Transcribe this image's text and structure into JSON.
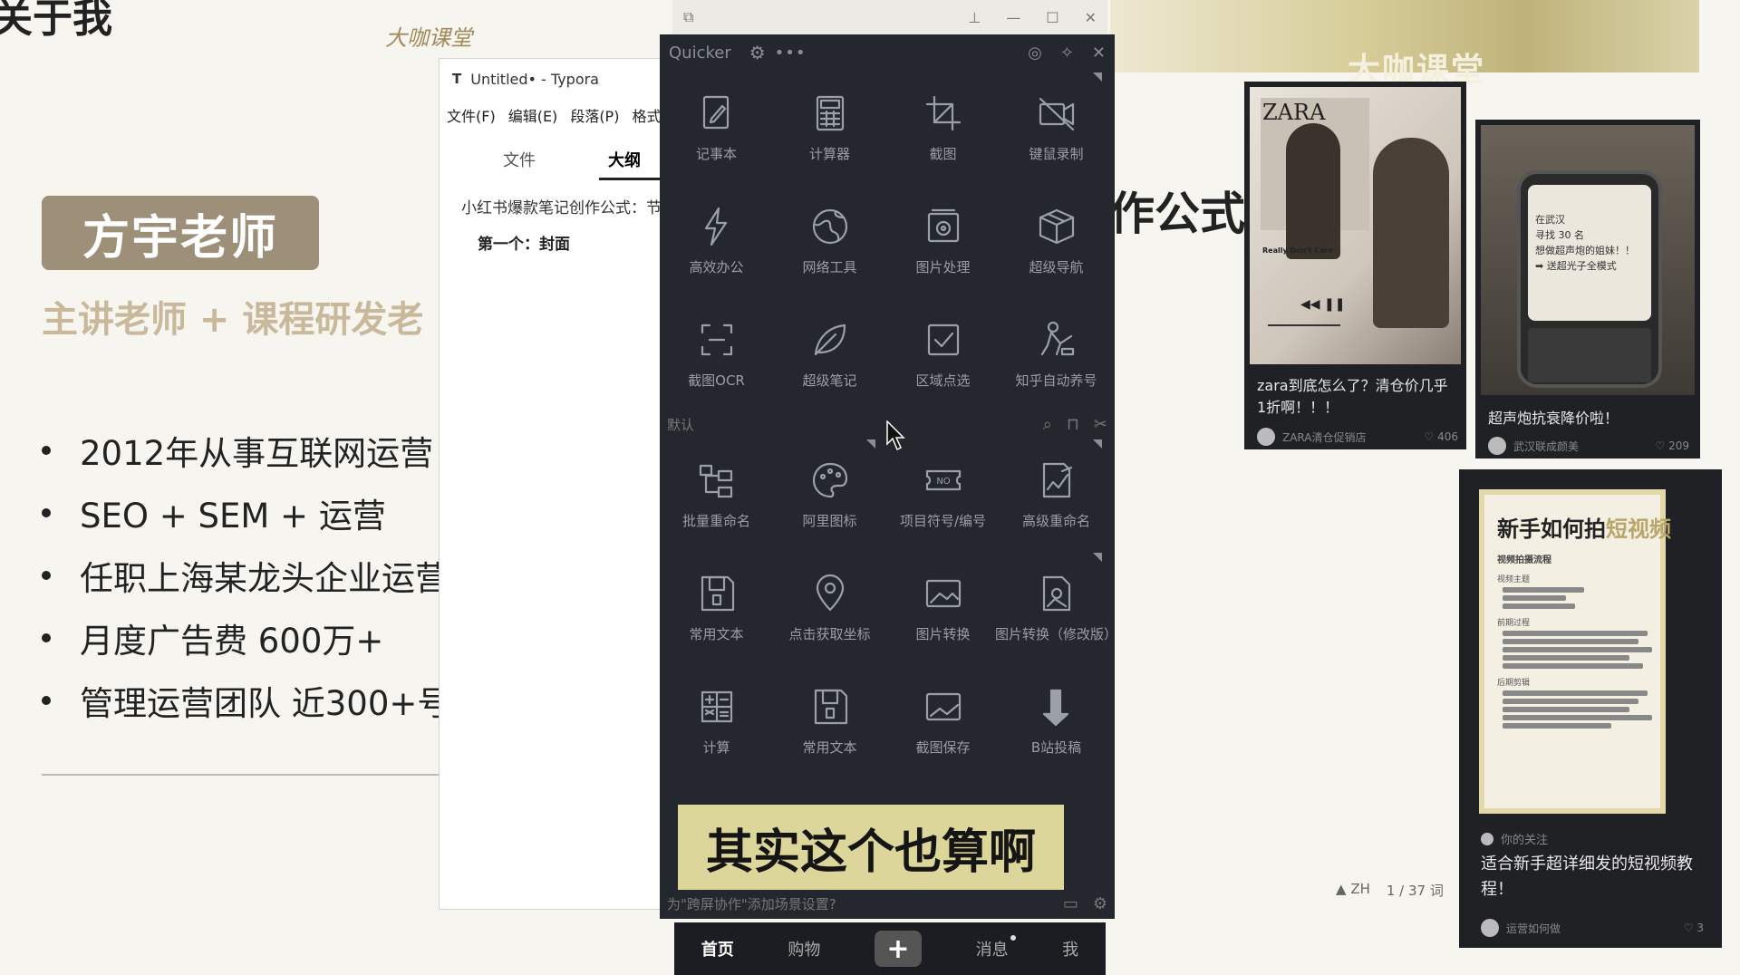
{
  "slide": {
    "title_fragment": "关于我",
    "brand": "大咖课堂",
    "teacher_name": "方宇老师",
    "teacher_role": "主讲老师 + 课程研发老",
    "bullets": [
      "2012年从事互联网运营",
      "SEO + SEM + 运营",
      "任职上海某龙头企业运营",
      "月度广告费 600万+",
      "管理运营团队 近300+号"
    ],
    "formula_text": "作公式",
    "top_watermark": "大咖课堂"
  },
  "typora": {
    "icon": "T",
    "title": "Untitled• - Typora",
    "menu": [
      "文件(F)",
      "编辑(E)",
      "段落(P)",
      "格式"
    ],
    "tab_files": "文件",
    "tab_outline": "大纲",
    "doc_line1": "小红书爆款笔记创作公式：节",
    "doc_line2": "第一个：封面",
    "status_lang": "ZH",
    "status_count": "1 / 37 词"
  },
  "quicker": {
    "app_name": "Quicker",
    "section_label": "默认",
    "footer_text": "为\"跨屏协作\"添加场景设置?",
    "caption": "其实这个也算啊",
    "grid_top": [
      {
        "label": "记事本",
        "icon": "notepad-icon"
      },
      {
        "label": "计算器",
        "icon": "calculator-icon"
      },
      {
        "label": "截图",
        "icon": "crop-icon"
      },
      {
        "label": "键鼠录制",
        "icon": "video-off-icon"
      },
      {
        "label": "高效办公",
        "icon": "lightning-icon"
      },
      {
        "label": "网络工具",
        "icon": "globe-icon"
      },
      {
        "label": "图片处理",
        "icon": "image-process-icon"
      },
      {
        "label": "超级导航",
        "icon": "box-icon"
      },
      {
        "label": "截图OCR",
        "icon": "ocr-icon"
      },
      {
        "label": "超级笔记",
        "icon": "leaf-icon"
      },
      {
        "label": "区域点选",
        "icon": "checkbox-icon"
      },
      {
        "label": "知乎自动养号",
        "icon": "worker-icon"
      }
    ],
    "grid_bottom": [
      {
        "label": "批量重命名",
        "icon": "tree-icon"
      },
      {
        "label": "阿里图标",
        "icon": "palette-icon"
      },
      {
        "label": "项目符号/编号",
        "icon": "no-ticket-icon"
      },
      {
        "label": "高级重命名",
        "icon": "image-edit-icon"
      },
      {
        "label": "常用文本",
        "icon": "save-icon"
      },
      {
        "label": "点击获取坐标",
        "icon": "pin-icon"
      },
      {
        "label": "图片转换",
        "icon": "picture-icon"
      },
      {
        "label": "图片转换（修改版）",
        "icon": "file-image-icon"
      },
      {
        "label": "计算",
        "icon": "calc-grid-icon"
      },
      {
        "label": "常用文本",
        "icon": "save-icon"
      },
      {
        "label": "截图保存",
        "icon": "picture-save-icon"
      },
      {
        "label": "B站投稿",
        "icon": "arrow-down-icon"
      }
    ]
  },
  "bottom_nav": [
    "首页",
    "购物",
    "+",
    "消息",
    "我"
  ],
  "cards": [
    {
      "title": "zara到底怎么了？清仓价几乎1折啊！！！",
      "author": "ZARA清仓促销店",
      "likes": "406",
      "photo_text": "ZARA",
      "photo_sub": "Really Don't Care"
    },
    {
      "title": "超声炮抗衰降价啦！",
      "author": "武汉联成颜美",
      "likes": "209",
      "phone_text": [
        "在武汉",
        "寻找 30 名",
        "想做超声炮的姐妹！！",
        "➡ 送超光子全模式"
      ]
    },
    {
      "title": "适合新手超详细发的短视频教程！",
      "label": "你的关注",
      "author": "运营如何做",
      "likes": "3",
      "poster_title_a": "新手如何拍",
      "poster_title_b": "短视频",
      "poster_sub": "视频拍摄流程",
      "poster_sections": [
        "视频主题",
        "前期过程",
        "后期剪辑"
      ]
    }
  ],
  "colors": {
    "quicker_bg": "#24272e",
    "caption_bg": "#ddd69a",
    "teacher_box": "#9d8f78"
  }
}
